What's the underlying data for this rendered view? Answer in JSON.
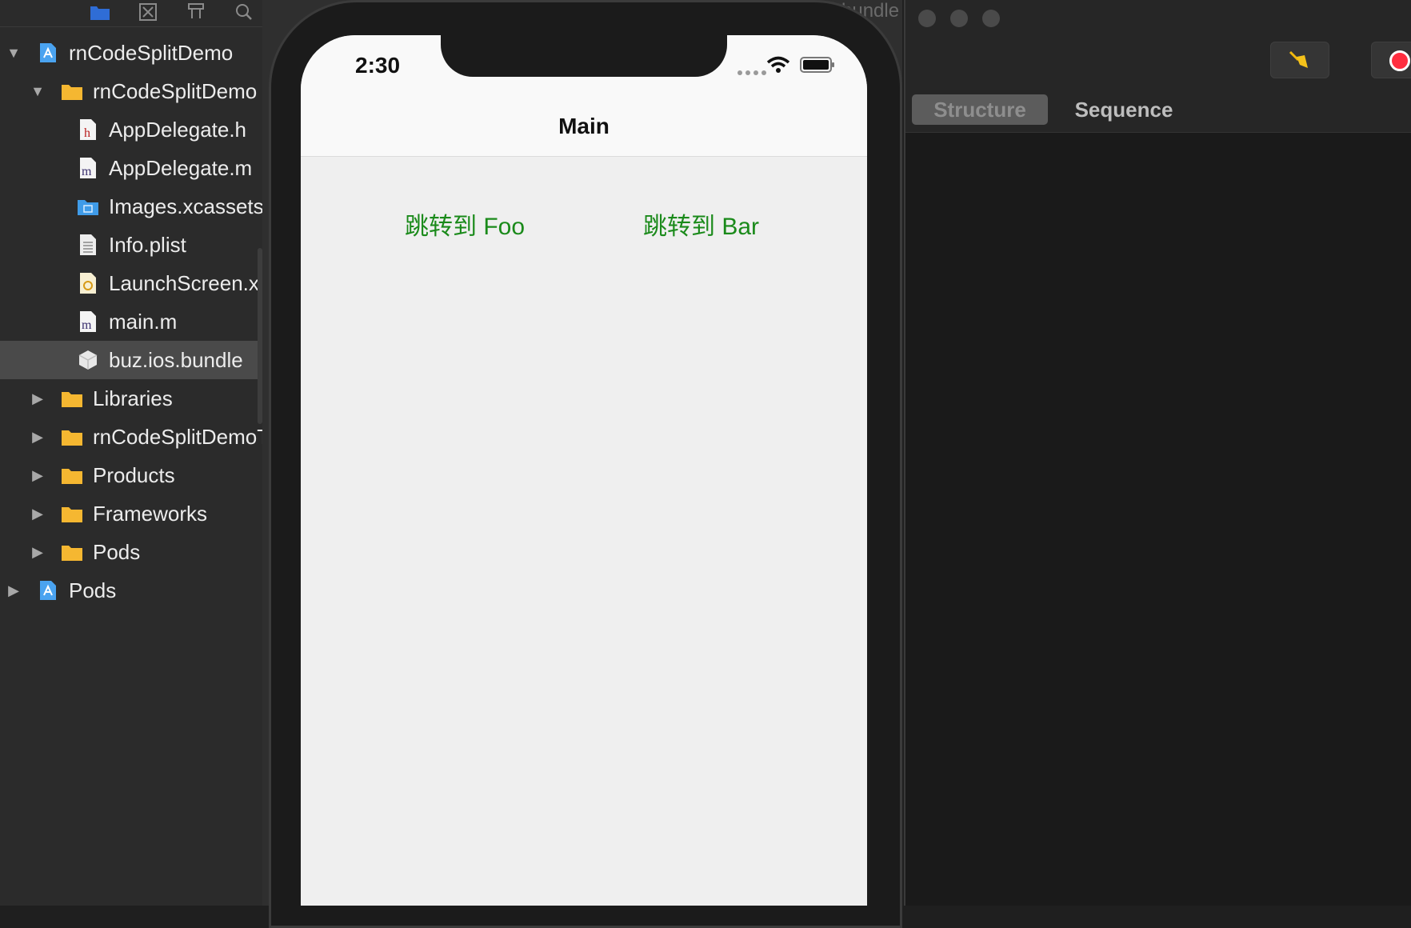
{
  "navigator": {
    "toolbar_icons": [
      "folder-icon",
      "source-control-icon",
      "hierarchy-icon",
      "search-icon",
      "warning-icon"
    ],
    "items": [
      {
        "label": "rnCodeSplitDemo",
        "icon": "xcode-project-icon",
        "disclosure": "expanded"
      },
      {
        "label": "rnCodeSplitDemo",
        "icon": "folder-icon",
        "disclosure": "expanded"
      },
      {
        "label": "AppDelegate.h",
        "icon": "header-file-icon",
        "disclosure": "none"
      },
      {
        "label": "AppDelegate.m",
        "icon": "objc-file-icon",
        "disclosure": "none"
      },
      {
        "label": "Images.xcassets",
        "icon": "asset-catalog-icon",
        "disclosure": "none"
      },
      {
        "label": "Info.plist",
        "icon": "plist-file-icon",
        "disclosure": "none"
      },
      {
        "label": "LaunchScreen.xib",
        "icon": "xib-file-icon",
        "disclosure": "none"
      },
      {
        "label": "main.m",
        "icon": "objc-file-icon",
        "disclosure": "none"
      },
      {
        "label": "buz.ios.bundle",
        "icon": "bundle-icon",
        "disclosure": "none",
        "selected": true
      },
      {
        "label": "Libraries",
        "icon": "folder-icon",
        "disclosure": "collapsed"
      },
      {
        "label": "rnCodeSplitDemoTests",
        "icon": "folder-icon",
        "disclosure": "collapsed"
      },
      {
        "label": "Products",
        "icon": "folder-icon",
        "disclosure": "collapsed"
      },
      {
        "label": "Frameworks",
        "icon": "folder-icon",
        "disclosure": "collapsed"
      },
      {
        "label": "Pods",
        "icon": "folder-icon",
        "disclosure": "collapsed"
      },
      {
        "label": "Pods",
        "icon": "xcode-project-icon",
        "disclosure": "collapsed"
      }
    ]
  },
  "simulator": {
    "tab_peek": "bundle",
    "status_bar": {
      "time": "2:30"
    },
    "nav_title": "Main",
    "buttons": {
      "foo": "跳转到 Foo",
      "bar": "跳转到 Bar"
    },
    "link_color": "#1a8a1a"
  },
  "inspector": {
    "tabs": {
      "structure": "Structure",
      "sequence": "Sequence"
    },
    "active_tab": "Structure",
    "toolbar_icons": [
      "broom-icon",
      "record-icon"
    ],
    "record_color": "#ff2d3f"
  }
}
